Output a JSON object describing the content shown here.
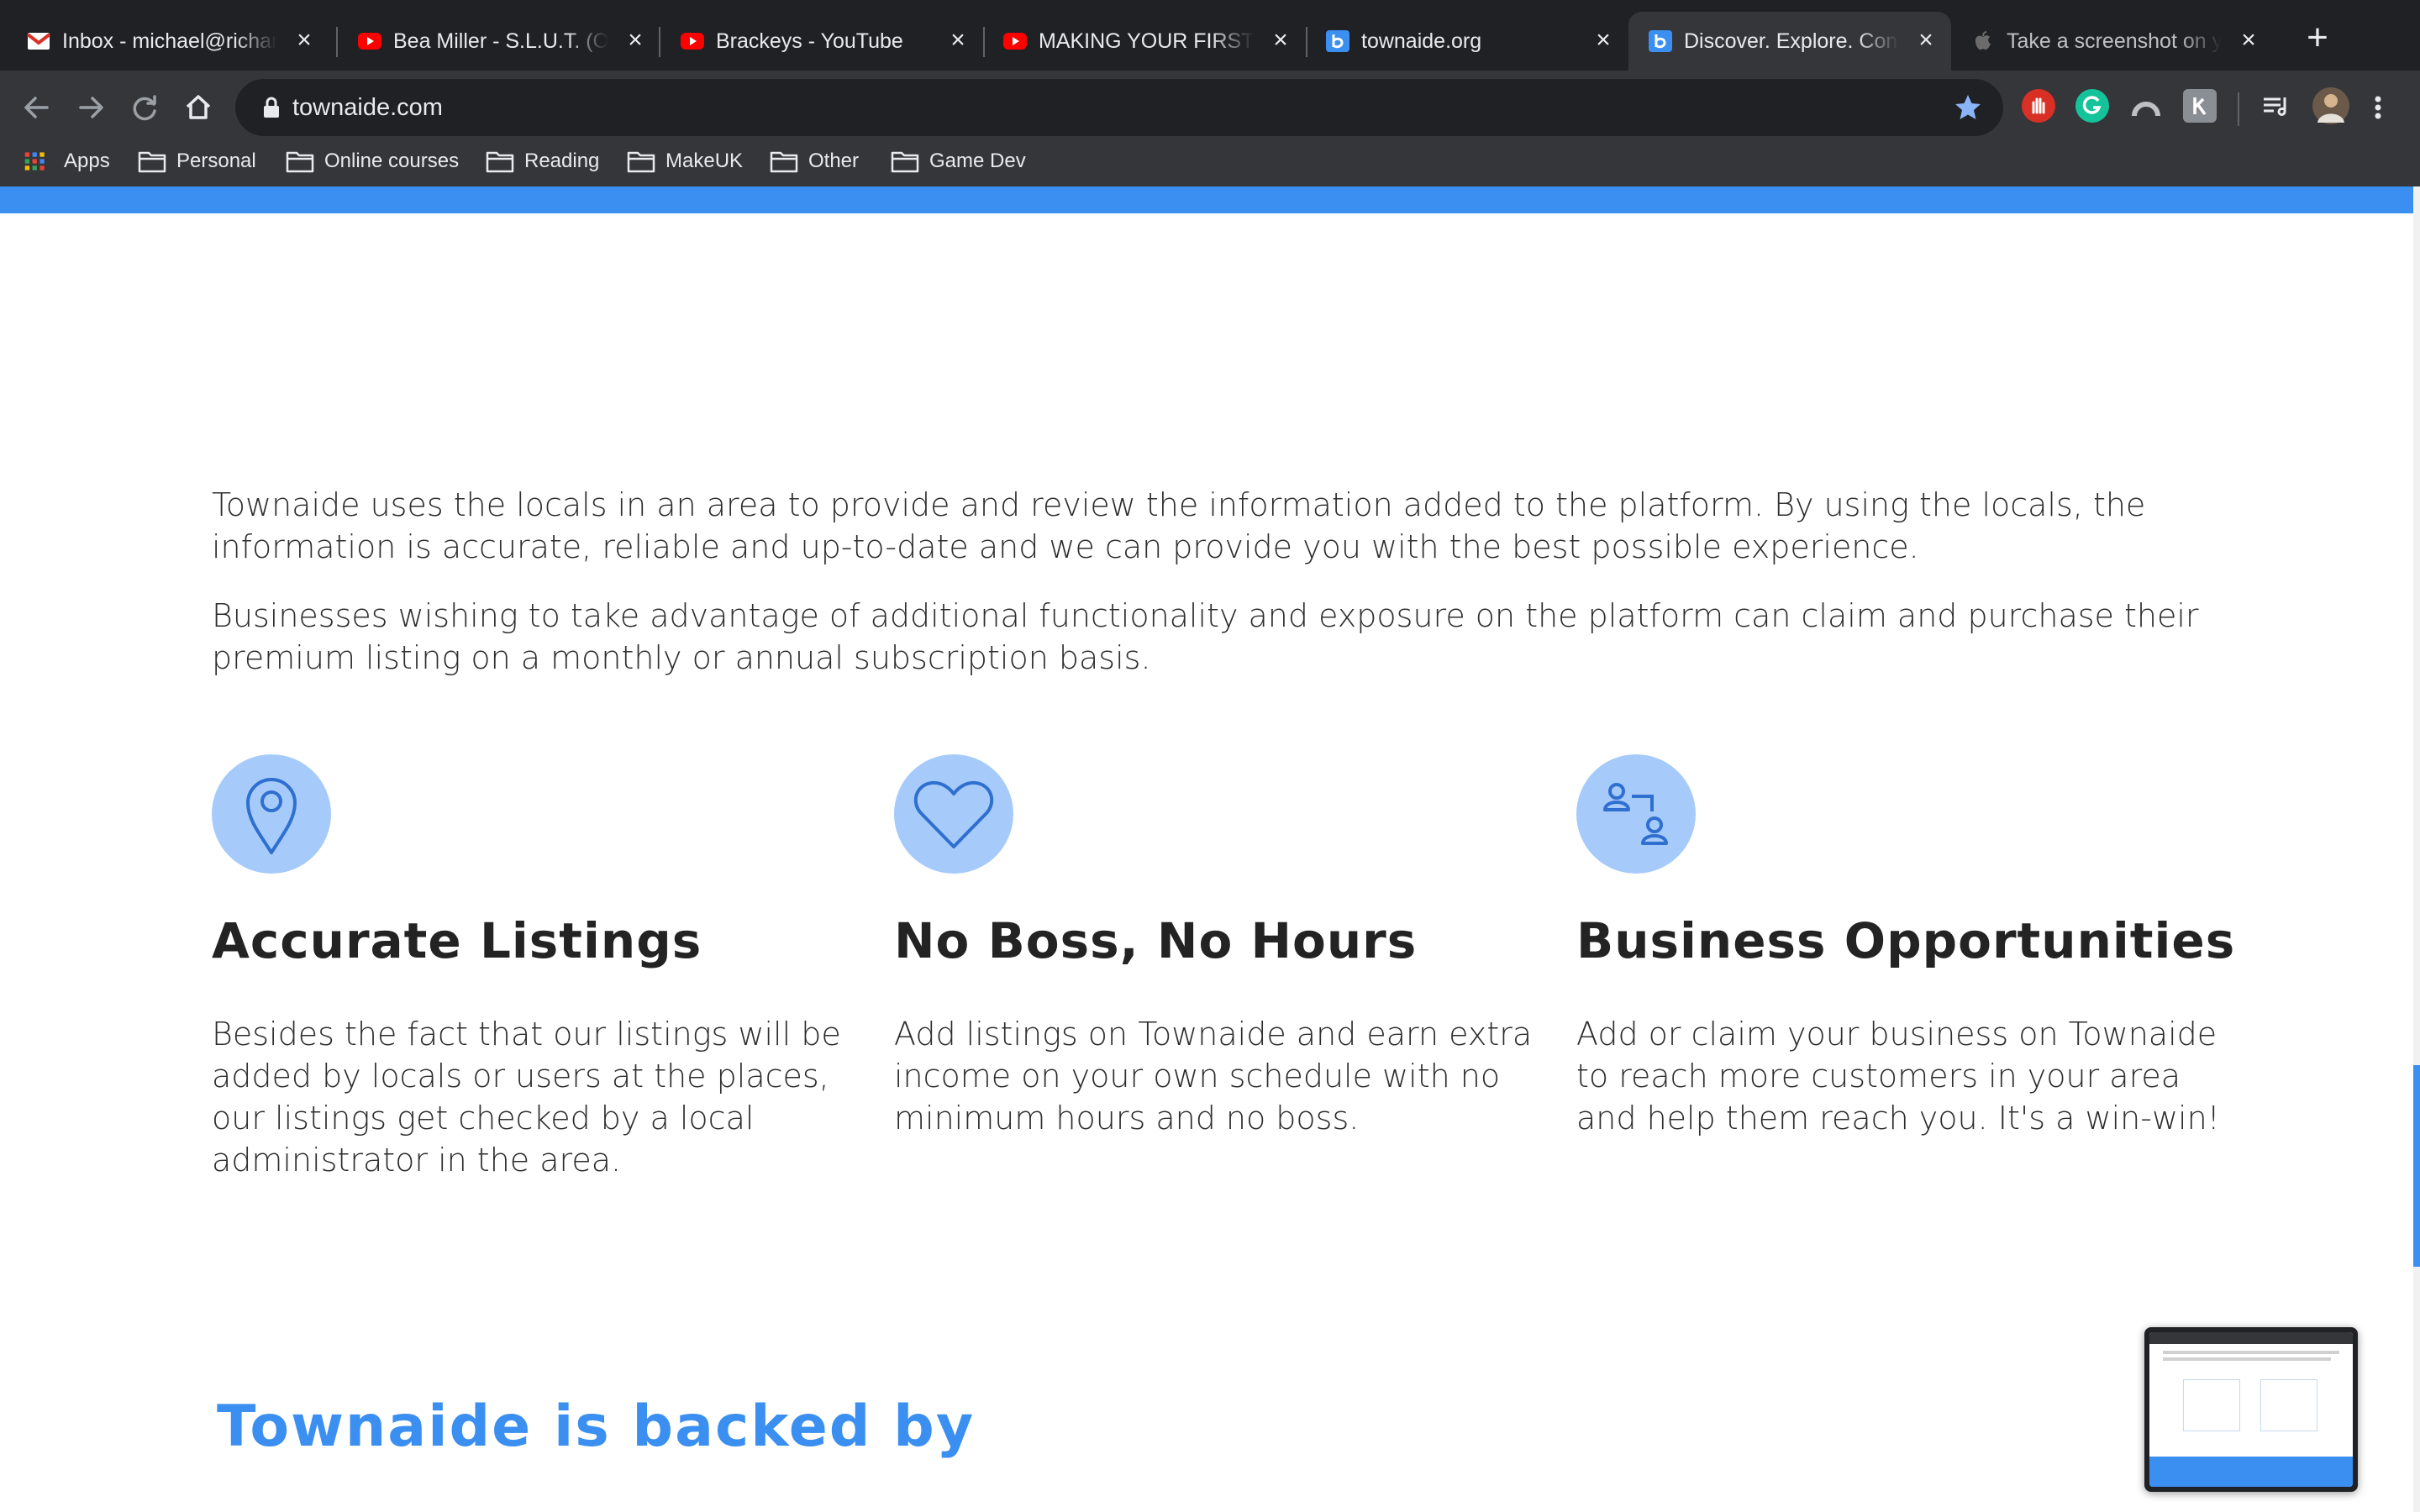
{
  "tabs": [
    {
      "title": "Inbox - michael@richarc",
      "favicon": "gmail-icon"
    },
    {
      "title": "Bea Miller - S.L.U.T. (Of",
      "favicon": "youtube-icon"
    },
    {
      "title": "Brackeys - YouTube",
      "favicon": "youtube-icon"
    },
    {
      "title": "MAKING YOUR FIRST LI",
      "favicon": "youtube-icon"
    },
    {
      "title": "townaide.org",
      "favicon": "townaide-icon"
    },
    {
      "title": "Discover. Explore. Conn",
      "favicon": "townaide-icon",
      "active": true
    },
    {
      "title": "Take a screenshot on yo",
      "favicon": "apple-icon"
    }
  ],
  "tab_close_glyph": "×",
  "new_tab_glyph": "+",
  "address_bar": {
    "url": "townaide.com",
    "starred": true
  },
  "bookmarks": [
    "Apps",
    "Personal",
    "Online courses",
    "Reading",
    "MakeUK",
    "Other",
    "Game Dev"
  ],
  "content": {
    "intro": [
      "Townaide uses the locals in an area to provide and review the information added to the platform. By using the locals, the information is accurate, reliable and up-to-date and we can provide you with the best possible experience.",
      "Businesses wishing to take advantage of additional functionality and exposure on the platform can claim and purchase their premium listing on a monthly or annual subscription basis."
    ],
    "features": [
      {
        "icon": "map-pin-icon",
        "title": "Accurate Listings",
        "text": "Besides the fact that our listings will be added by locals or users at the places, our listings get checked by a local administrator in the area."
      },
      {
        "icon": "heart-icon",
        "title": "No Boss, No Hours",
        "text": "Add listings on Townaide and earn extra income on your own schedule with no minimum hours and no boss."
      },
      {
        "icon": "users-network-icon",
        "title": "Business Opportunities",
        "text": "Add or claim your business on Townaide to reach more customers in your area and help them reach you. It's a win-win!"
      }
    ],
    "backed_heading": "Townaide is backed by"
  },
  "colors": {
    "accent_blue": "#3b8ff0",
    "icon_circle": "#a6cbfb",
    "icon_stroke": "#2f6fcf",
    "chrome_dark": "#202124",
    "chrome_mid": "#35363a"
  }
}
